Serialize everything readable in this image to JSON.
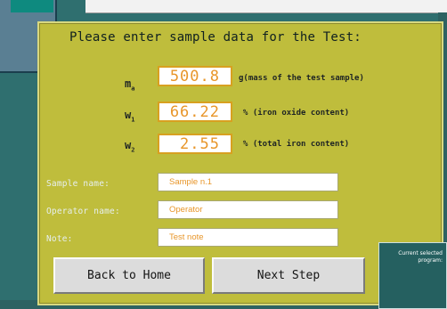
{
  "form": {
    "title": "Please enter sample data for the Test:",
    "mass": {
      "symbol": "m",
      "subscript": "a",
      "value": "500.8",
      "unit_label": "g(mass of the test sample)"
    },
    "iron_oxide": {
      "symbol": "w",
      "subscript": "1",
      "value": "66.22",
      "unit_label": "% (iron oxide content)"
    },
    "total_iron": {
      "symbol": "w",
      "subscript": "2",
      "value": "2.55",
      "unit_label": "% (total iron content)"
    },
    "sample_name": {
      "label": "Sample name:",
      "value": "Sample n.1"
    },
    "operator_name": {
      "label": "Operator name:",
      "value": "Operator"
    },
    "note": {
      "label": "Note:",
      "value": "Test note"
    }
  },
  "buttons": {
    "back_label": "Back to Home",
    "next_label": "Next Step"
  },
  "program": {
    "label": "Current selected program:"
  },
  "colors": {
    "panel_bg": "#bfbd3c",
    "desktop_bg": "#2f6f6f",
    "value_text": "#e8962a",
    "value_border": "#d8a020",
    "program_bg": "#256060"
  }
}
